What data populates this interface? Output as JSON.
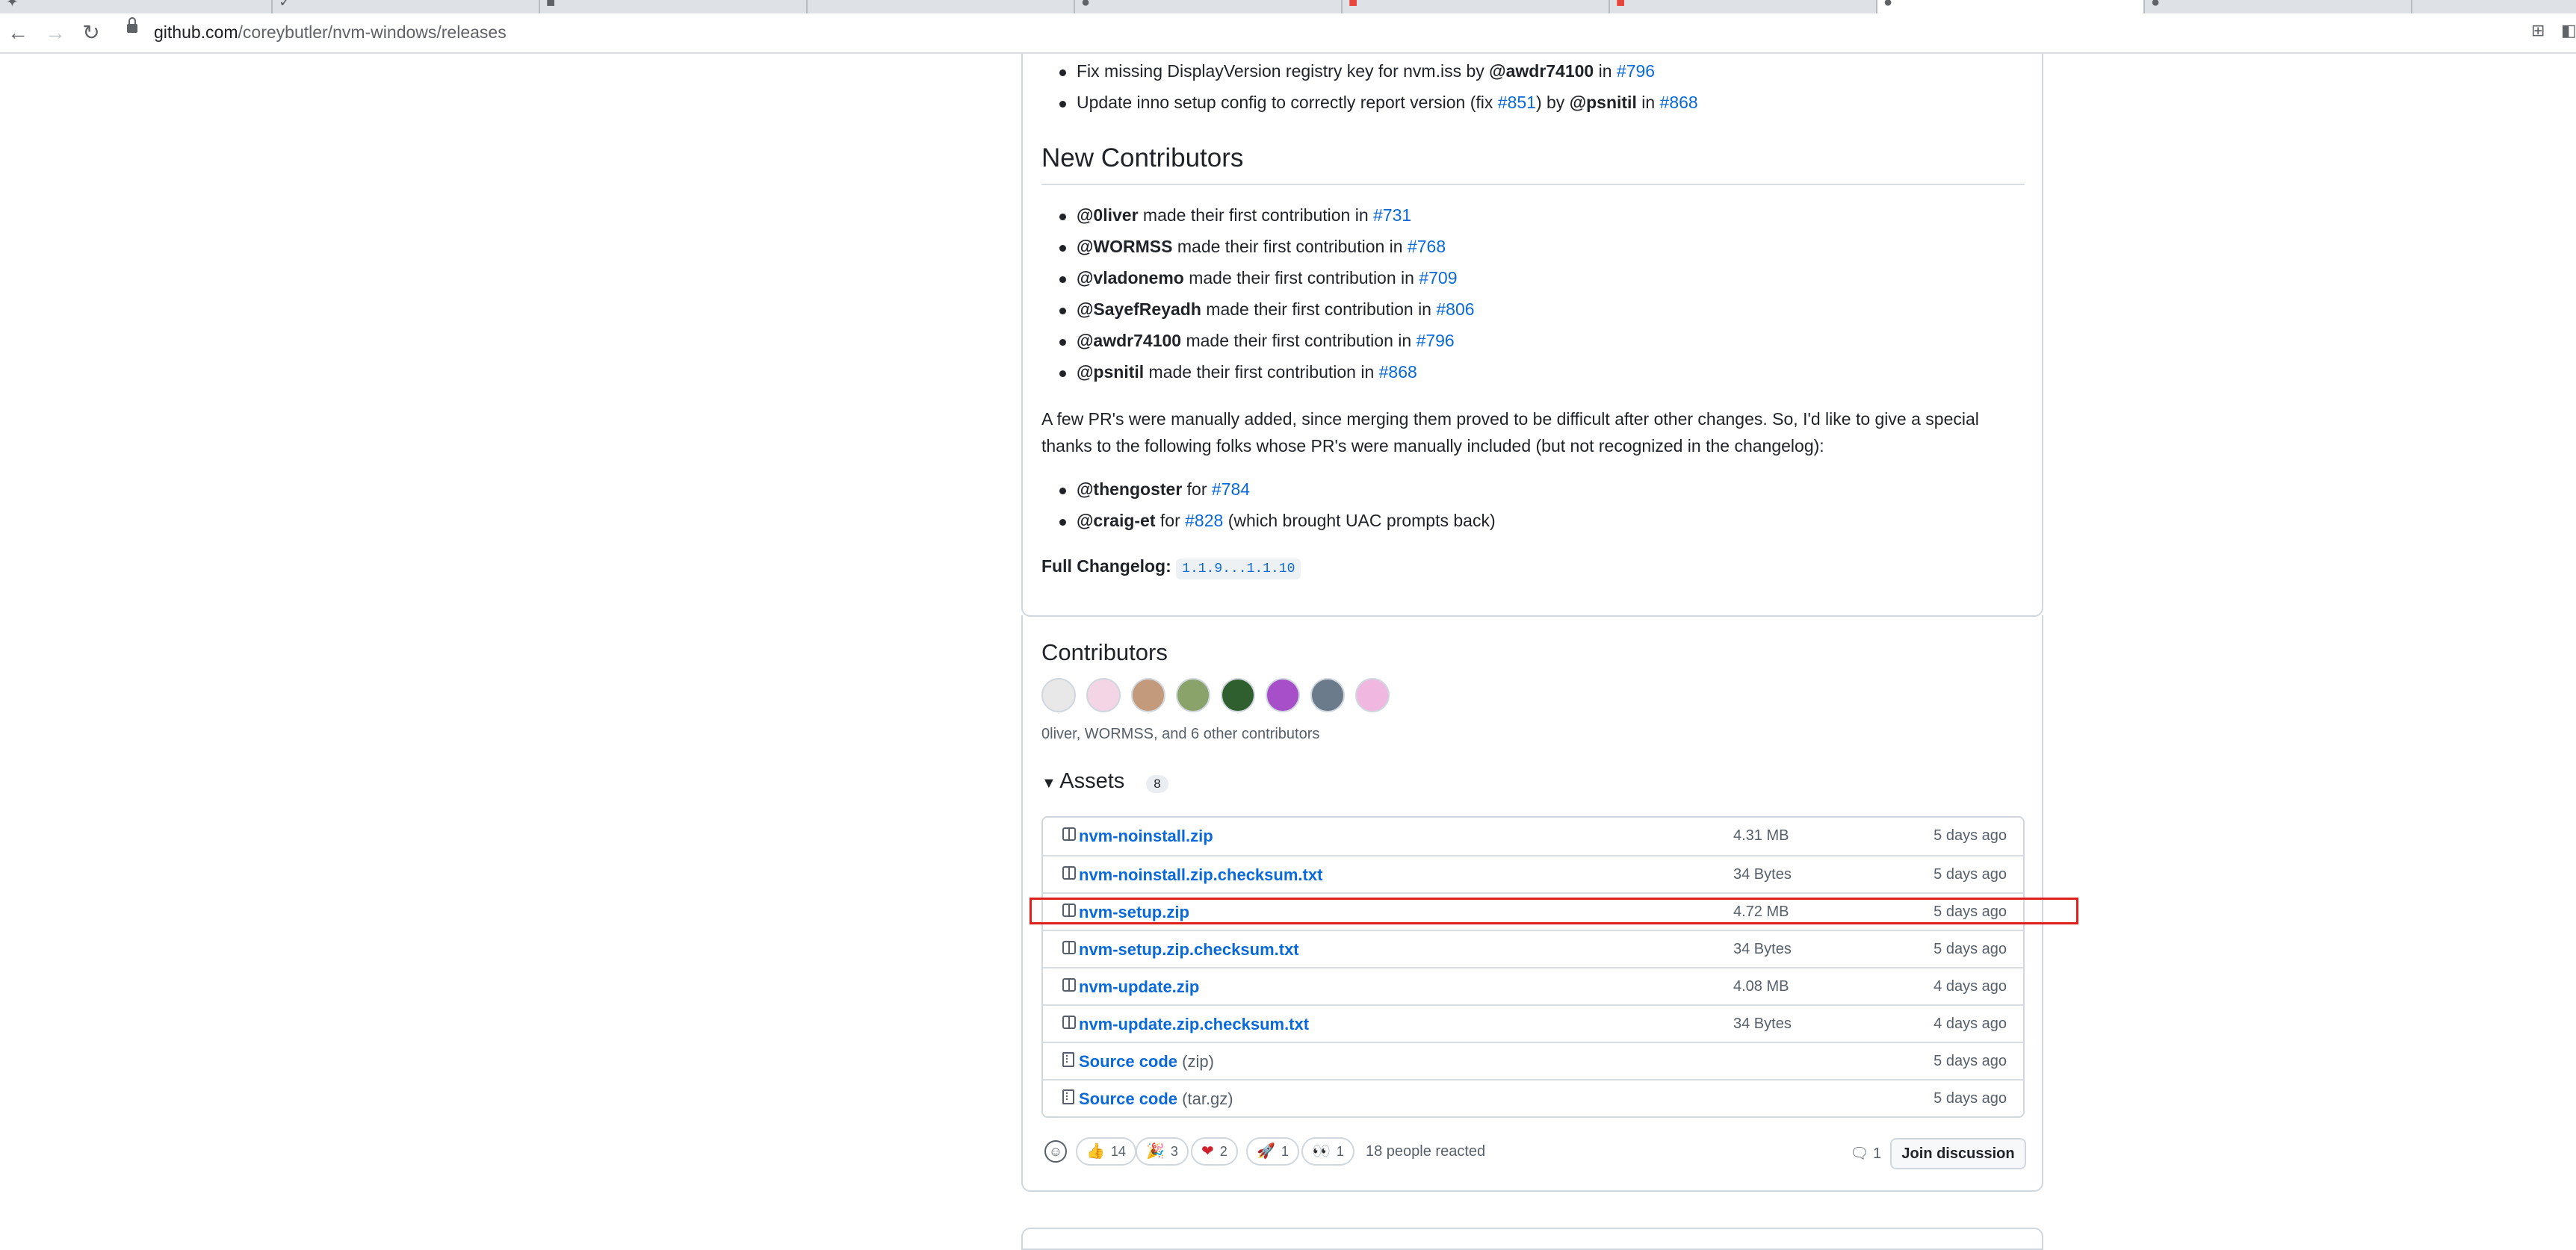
{
  "browser": {
    "tabs": [
      "",
      "",
      "",
      "",
      "",
      "",
      "",
      "",
      "",
      ""
    ],
    "url_host": "github.com",
    "url_path": "/coreybutler/nvm-windows/releases"
  },
  "changes": [
    {
      "pre": "Fix missing DisplayVersion registry key for nvm.iss by ",
      "mention": "@awdr74100",
      "mid": " in ",
      "link": "#796",
      "post": ""
    },
    {
      "pre": "Update inno setup config to correctly report version (fix ",
      "link1": "#851",
      "mid1": ") by ",
      "mention": "@psnitil",
      "mid": " in ",
      "link": "#868",
      "post": ""
    }
  ],
  "new_contributors": {
    "heading": "New Contributors",
    "items": [
      {
        "mention": "@0liver",
        "text": " made their first contribution in ",
        "link": "#731"
      },
      {
        "mention": "@WORMSS",
        "text": " made their first contribution in ",
        "link": "#768"
      },
      {
        "mention": "@vladonemo",
        "text": " made their first contribution in ",
        "link": "#709"
      },
      {
        "mention": "@SayefReyadh",
        "text": " made their first contribution in ",
        "link": "#806"
      },
      {
        "mention": "@awdr74100",
        "text": " made their first contribution in ",
        "link": "#796"
      },
      {
        "mention": "@psnitil",
        "text": " made their first contribution in ",
        "link": "#868"
      }
    ]
  },
  "paragraph": {
    "line1": "A few PR's were manually added, since merging them proved to be difficult after other changes. So, I'd like to give a special",
    "line2": "thanks to the following folks whose PR's were manually included (but not recognized in the changelog):"
  },
  "manual": [
    {
      "mention": "@thengoster",
      "text": " for ",
      "link": "#784",
      "post": ""
    },
    {
      "mention": "@craig-et",
      "text": " for ",
      "link": "#828",
      "post": " (which brought UAC prompts back)"
    }
  ],
  "full_changelog": {
    "label": "Full Changelog:",
    "code": "1.1.9...1.1.10"
  },
  "contributors": {
    "title": "Contributors",
    "summary": "0liver, WORMSS, and 6 other contributors",
    "avatar_colors": [
      "#e8e8e8",
      "#f4d5e6",
      "#c49a7c",
      "#8aa36a",
      "#2f5e2f",
      "#a64fc9",
      "#6b7b8b",
      "#f0b7e0"
    ]
  },
  "assets": {
    "title": "Assets",
    "count": "8",
    "rows": [
      {
        "name": "nvm-noinstall.zip",
        "suffix": "",
        "size": "4.31 MB",
        "date": "5 days ago",
        "icon": "package-icon"
      },
      {
        "name": "nvm-noinstall.zip.checksum.txt",
        "suffix": "",
        "size": "34 Bytes",
        "date": "5 days ago",
        "icon": "package-icon"
      },
      {
        "name": "nvm-setup.zip",
        "suffix": "",
        "size": "4.72 MB",
        "date": "5 days ago",
        "icon": "package-icon"
      },
      {
        "name": "nvm-setup.zip.checksum.txt",
        "suffix": "",
        "size": "34 Bytes",
        "date": "5 days ago",
        "icon": "package-icon"
      },
      {
        "name": "nvm-update.zip",
        "suffix": "",
        "size": "4.08 MB",
        "date": "4 days ago",
        "icon": "package-icon"
      },
      {
        "name": "nvm-update.zip.checksum.txt",
        "suffix": "",
        "size": "34 Bytes",
        "date": "4 days ago",
        "icon": "package-icon"
      },
      {
        "name": "Source code",
        "suffix": " (zip)",
        "size": "",
        "date": "5 days ago",
        "icon": "file-zip-icon"
      },
      {
        "name": "Source code",
        "suffix": " (tar.gz)",
        "size": "",
        "date": "5 days ago",
        "icon": "file-zip-icon"
      }
    ]
  },
  "reactions": {
    "items": [
      {
        "emoji": "👍",
        "count": "14"
      },
      {
        "emoji": "🎉",
        "count": "3"
      },
      {
        "emoji": "❤",
        "count": "2"
      },
      {
        "emoji": "🚀",
        "count": "1"
      },
      {
        "emoji": "👀",
        "count": "1"
      }
    ],
    "summary": "18 people reacted",
    "comments": "1",
    "join_label": "Join discussion"
  },
  "colors": {
    "link": "#0969da",
    "highlight": "#e0201c",
    "border": "#d0d7de"
  }
}
